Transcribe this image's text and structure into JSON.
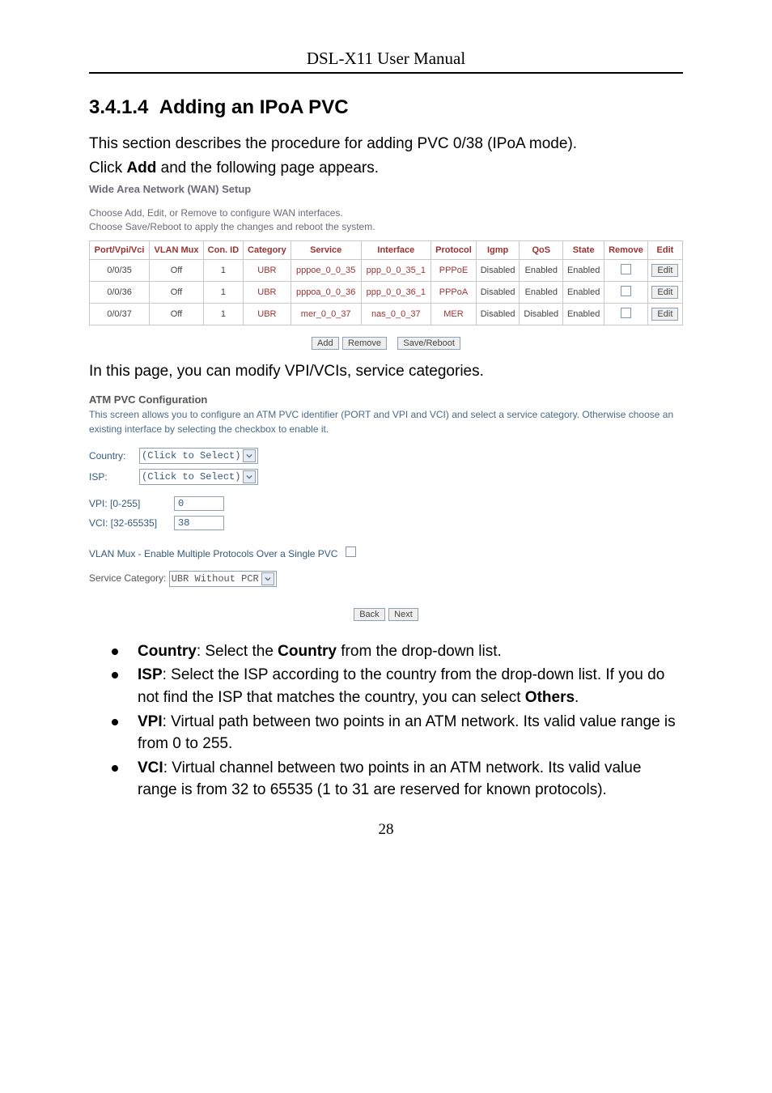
{
  "running_head": "DSL-X11 User Manual",
  "section_number": "3.4.1.4",
  "section_title": "Adding an IPoA PVC",
  "intro1": "This section describes the procedure for adding PVC 0/38 (IPoA mode).",
  "intro2_a": "Click ",
  "intro2_b": "Add",
  "intro2_c": " and the following page appears.",
  "wan": {
    "title": "Wide Area Network (WAN) Setup",
    "line1": "Choose Add, Edit, or Remove to configure WAN interfaces.",
    "line2": "Choose Save/Reboot to apply the changes and reboot the system.",
    "headers": [
      "Port/Vpi/Vci",
      "VLAN Mux",
      "Con. ID",
      "Category",
      "Service",
      "Interface",
      "Protocol",
      "Igmp",
      "QoS",
      "State",
      "Remove",
      "Edit"
    ],
    "rows": [
      {
        "port": "0/0/35",
        "mux": "Off",
        "con": "1",
        "cat": "UBR",
        "svc": "pppoe_0_0_35",
        "iface": "ppp_0_0_35_1",
        "proto": "PPPoE",
        "igmp": "Disabled",
        "qos": "Enabled",
        "state": "Enabled",
        "edit": "Edit"
      },
      {
        "port": "0/0/36",
        "mux": "Off",
        "con": "1",
        "cat": "UBR",
        "svc": "pppoa_0_0_36",
        "iface": "ppp_0_0_36_1",
        "proto": "PPPoA",
        "igmp": "Disabled",
        "qos": "Enabled",
        "state": "Enabled",
        "edit": "Edit"
      },
      {
        "port": "0/0/37",
        "mux": "Off",
        "con": "1",
        "cat": "UBR",
        "svc": "mer_0_0_37",
        "iface": "nas_0_0_37",
        "proto": "MER",
        "igmp": "Disabled",
        "qos": "Disabled",
        "state": "Enabled",
        "edit": "Edit"
      }
    ],
    "btn_add": "Add",
    "btn_remove": "Remove",
    "btn_save": "Save/Reboot"
  },
  "mid_line": "In this page, you can modify VPI/VCIs, service categories.",
  "atm": {
    "title": "ATM PVC Configuration",
    "desc": "This screen allows you to configure an ATM PVC identifier (PORT and VPI and VCI) and select a service category. Otherwise choose an existing interface by selecting the checkbox to enable it.",
    "country_lbl": "Country:",
    "country_val": "(Click to Select)",
    "isp_lbl": "ISP:",
    "isp_val": "(Click to Select)",
    "vpi_lbl": "VPI: [0-255]",
    "vpi_val": "0",
    "vci_lbl": "VCI: [32-65535]",
    "vci_val": "38",
    "vlan_lbl": "VLAN Mux - Enable Multiple Protocols Over a Single PVC",
    "sc_lbl": "Service Category:",
    "sc_val": "UBR Without PCR",
    "btn_back": "Back",
    "btn_next": "Next"
  },
  "bullets": {
    "country_a": "Country",
    "country_b": ": Select the ",
    "country_c": "Country",
    "country_d": " from the drop-down list.",
    "isp_a": "ISP",
    "isp_b": ": Select the ISP according to the country from the drop-down list. If you do not find the ISP that matches the country, you can select ",
    "isp_c": "Others",
    "isp_d": ".",
    "vpi_a": "VPI",
    "vpi_b": ": Virtual path between two points in an ATM network. Its valid value range is from 0 to 255.",
    "vci_a": "VCI",
    "vci_b": ": Virtual channel between two points in an ATM network. Its valid value range is from 32 to 65535 (1 to 31 are reserved for known protocols)."
  },
  "page_number": "28"
}
